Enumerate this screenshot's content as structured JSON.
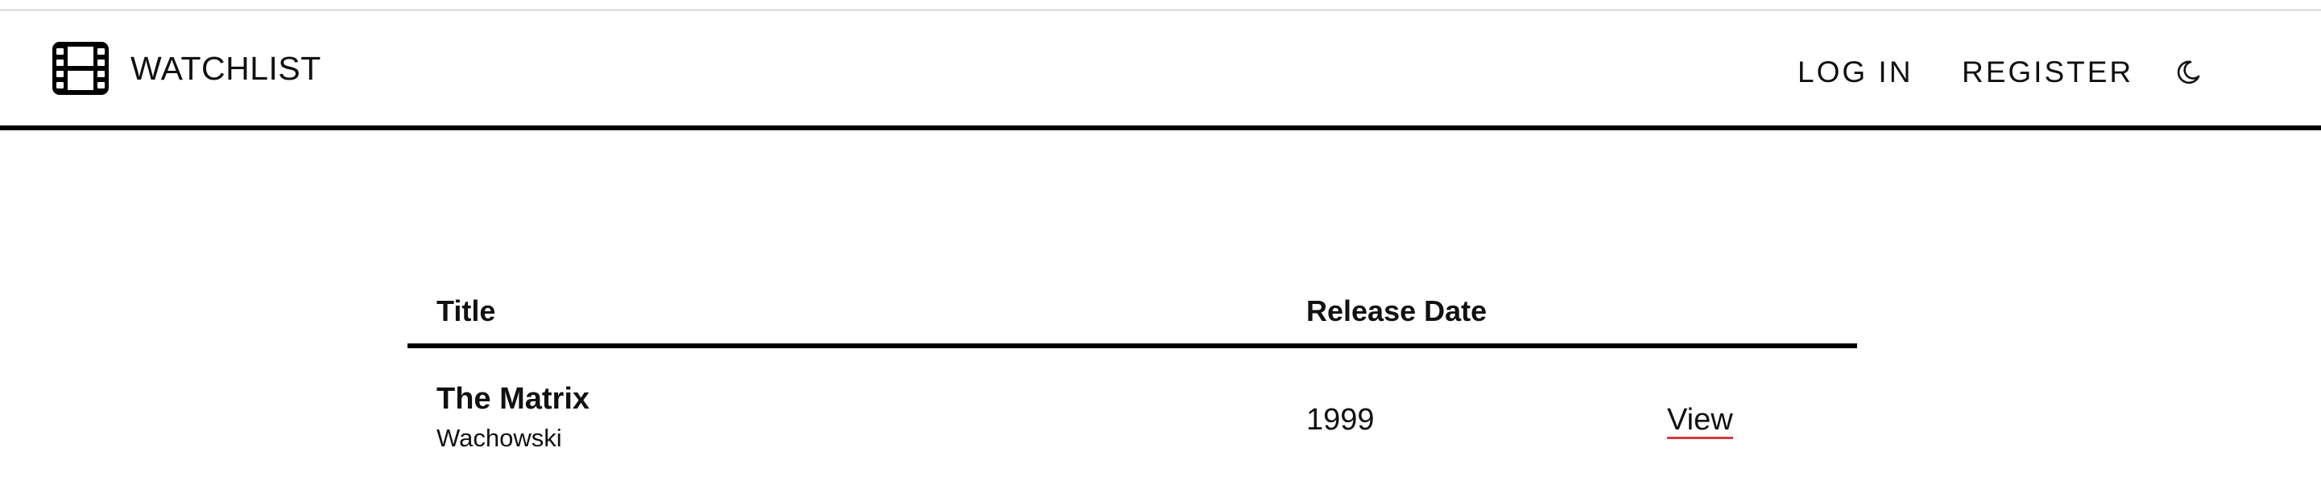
{
  "header": {
    "brand_title": "WATCHLIST",
    "brand_icon": "film-icon",
    "nav": {
      "login_label": "LOG IN",
      "register_label": "REGISTER"
    },
    "theme_toggle_icon": "moon-icon"
  },
  "table": {
    "columns": [
      "Title",
      "Release Date"
    ],
    "rows": [
      {
        "title": "The Matrix",
        "director": "Wachowski",
        "release_date": "1999",
        "action_label": "View"
      }
    ]
  },
  "colors": {
    "text": "#111111",
    "rule": "#000000",
    "link_underline": "#d63a3a"
  }
}
